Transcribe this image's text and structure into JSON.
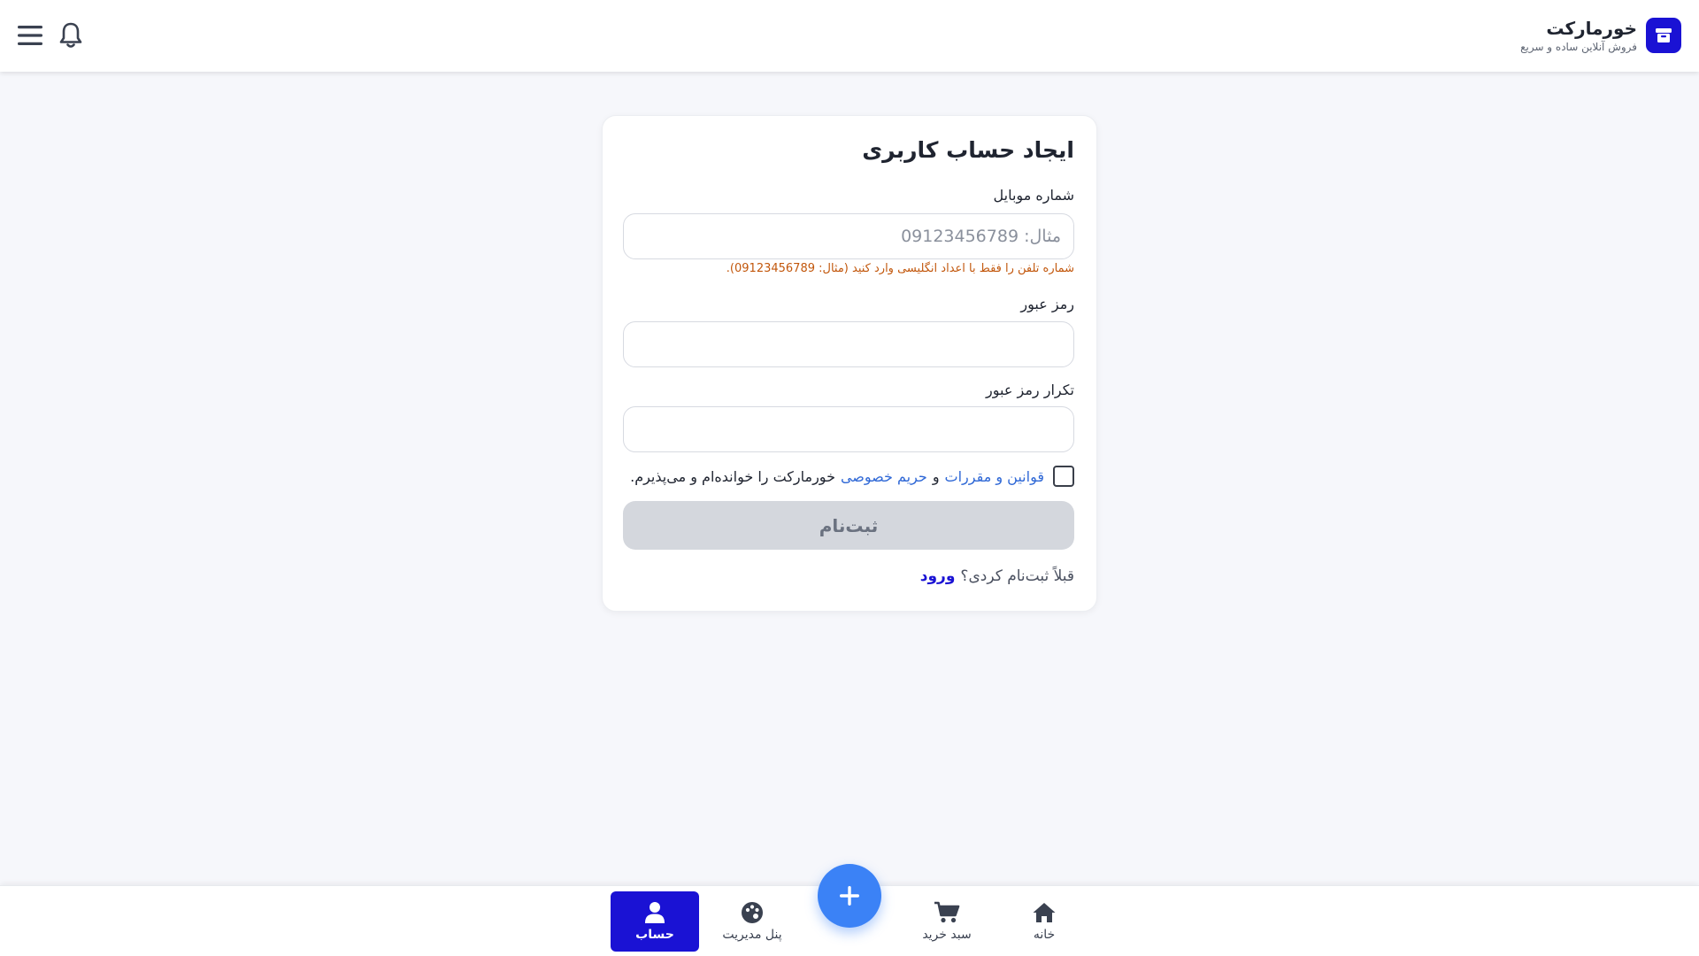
{
  "header": {
    "brand_name": "خورمارکت",
    "brand_tagline": "فروش آنلاین ساده و سریع",
    "icons": {
      "logo": "store-icon",
      "notifications": "bell-icon",
      "menu": "hamburger-menu-icon"
    }
  },
  "form": {
    "title": "ایجاد حساب کاربری",
    "phone": {
      "label": "شماره موبایل",
      "placeholder": "مثال: 09123456789",
      "value": "",
      "error": "شماره تلفن را فقط با اعداد انگلیسی وارد کنید (مثال: 09123456789)."
    },
    "password": {
      "label": "رمز عبور",
      "value": ""
    },
    "password_confirm": {
      "label": "تکرار رمز عبور",
      "value": ""
    },
    "terms": {
      "checked": false,
      "link_rules": "قوانین و مقررات",
      "and": "و",
      "link_privacy": "حریم خصوصی",
      "suffix": "خورمارکت را خوانده‌ام و می‌پذیرم."
    },
    "submit_label": "ثبت‌نام",
    "submit_disabled": true,
    "login_prompt": "قبلاً ثبت‌نام کردی؟",
    "login_link": "ورود"
  },
  "bottom_nav": {
    "items": [
      {
        "label": "خانه",
        "icon": "home-icon",
        "active": false
      },
      {
        "label": "سبد خرید",
        "icon": "cart-icon",
        "active": false
      },
      {
        "label": "پنل مدیریت",
        "icon": "palette-icon",
        "active": false
      },
      {
        "label": "حساب",
        "icon": "user-icon",
        "active": true
      }
    ],
    "fab_icon": "plus-icon"
  },
  "colors": {
    "brand": "#1a12d4",
    "fab": "#3b82f6",
    "link": "#2f68d6",
    "error": "#c2570c",
    "button_disabled": "#d4d7dd",
    "page_background": "#f6f7fb"
  }
}
